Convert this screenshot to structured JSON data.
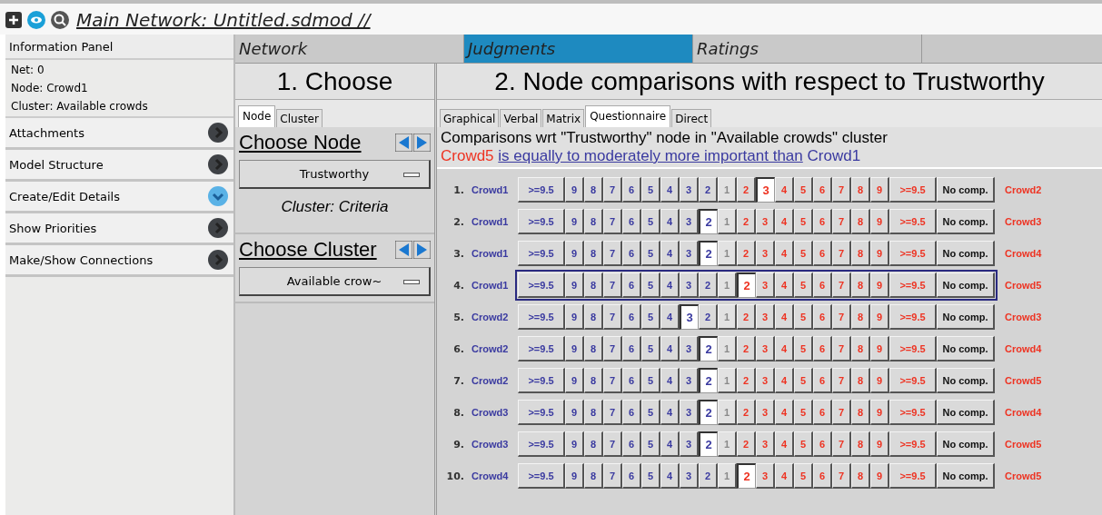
{
  "window": {
    "title": "Main Network: Untitled.sdmod //"
  },
  "sidebar": {
    "header": "Information Panel",
    "info": [
      "Net: 0",
      "Node: Crowd1",
      "Cluster: Available crowds"
    ],
    "sections": [
      {
        "label": "Attachments",
        "expanded": false
      },
      {
        "label": "Model Structure",
        "expanded": false
      },
      {
        "label": "Create/Edit Details",
        "expanded": true
      },
      {
        "label": "Show Priorities",
        "expanded": false
      },
      {
        "label": "Make/Show Connections",
        "expanded": false
      }
    ]
  },
  "main_tabs": [
    {
      "label": "Network",
      "selected": false
    },
    {
      "label": "Judgments",
      "selected": true
    },
    {
      "label": "Ratings",
      "selected": false
    }
  ],
  "choose": {
    "heading": "1. Choose",
    "tabs": [
      {
        "label": "Node",
        "selected": true
      },
      {
        "label": "Cluster",
        "selected": false
      }
    ],
    "node_title": "Choose Node",
    "node_value": "Trustworthy",
    "cluster_note": "Cluster: Criteria",
    "cluster_title": "Choose Cluster",
    "cluster_value": "Available crow~"
  },
  "comparisons": {
    "heading": "2. Node comparisons with respect to Trustworthy",
    "tabs": [
      {
        "label": "Graphical",
        "selected": false
      },
      {
        "label": "Verbal",
        "selected": false
      },
      {
        "label": "Matrix",
        "selected": false
      },
      {
        "label": "Questionnaire",
        "selected": true
      },
      {
        "label": "Direct",
        "selected": false
      }
    ],
    "caption": "Comparisons wrt \"Trustworthy\" node in \"Available crowds\" cluster",
    "verdict": {
      "subject": "Crowd5",
      "phrase": "is equally to moderately more important than",
      "object": "Crowd1"
    },
    "rows": [
      {
        "number": "1.",
        "left": "Crowd1",
        "right": "Crowd2",
        "focused": false,
        "cells": [
          {
            "label": ">=9.5",
            "kind": "left",
            "selected": false
          },
          {
            "label": "9",
            "kind": "left",
            "selected": false
          },
          {
            "label": "8",
            "kind": "left",
            "selected": false
          },
          {
            "label": "7",
            "kind": "left",
            "selected": false
          },
          {
            "label": "6",
            "kind": "left",
            "selected": false
          },
          {
            "label": "5",
            "kind": "left",
            "selected": false
          },
          {
            "label": "4",
            "kind": "left",
            "selected": false
          },
          {
            "label": "3",
            "kind": "left",
            "selected": false
          },
          {
            "label": "2",
            "kind": "left",
            "selected": false
          },
          {
            "label": "1",
            "kind": "middle",
            "selected": false
          },
          {
            "label": "2",
            "kind": "right",
            "selected": false
          },
          {
            "label": "3",
            "kind": "right",
            "selected": true
          },
          {
            "label": "4",
            "kind": "right",
            "selected": false
          },
          {
            "label": "5",
            "kind": "right",
            "selected": false
          },
          {
            "label": "6",
            "kind": "right",
            "selected": false
          },
          {
            "label": "7",
            "kind": "right",
            "selected": false
          },
          {
            "label": "8",
            "kind": "right",
            "selected": false
          },
          {
            "label": "9",
            "kind": "right",
            "selected": false
          },
          {
            "label": ">=9.5",
            "kind": "right",
            "selected": false
          },
          {
            "label": "No comp.",
            "kind": "none",
            "selected": false
          }
        ]
      },
      {
        "number": "2.",
        "left": "Crowd1",
        "right": "Crowd3",
        "focused": false,
        "cells": [
          {
            "label": ">=9.5",
            "kind": "left",
            "selected": false
          },
          {
            "label": "9",
            "kind": "left",
            "selected": false
          },
          {
            "label": "8",
            "kind": "left",
            "selected": false
          },
          {
            "label": "7",
            "kind": "left",
            "selected": false
          },
          {
            "label": "6",
            "kind": "left",
            "selected": false
          },
          {
            "label": "5",
            "kind": "left",
            "selected": false
          },
          {
            "label": "4",
            "kind": "left",
            "selected": false
          },
          {
            "label": "3",
            "kind": "left",
            "selected": false
          },
          {
            "label": "2",
            "kind": "left",
            "selected": true
          },
          {
            "label": "1",
            "kind": "middle",
            "selected": false
          },
          {
            "label": "2",
            "kind": "right",
            "selected": false
          },
          {
            "label": "3",
            "kind": "right",
            "selected": false
          },
          {
            "label": "4",
            "kind": "right",
            "selected": false
          },
          {
            "label": "5",
            "kind": "right",
            "selected": false
          },
          {
            "label": "6",
            "kind": "right",
            "selected": false
          },
          {
            "label": "7",
            "kind": "right",
            "selected": false
          },
          {
            "label": "8",
            "kind": "right",
            "selected": false
          },
          {
            "label": "9",
            "kind": "right",
            "selected": false
          },
          {
            "label": ">=9.5",
            "kind": "right",
            "selected": false
          },
          {
            "label": "No comp.",
            "kind": "none",
            "selected": false
          }
        ]
      },
      {
        "number": "3.",
        "left": "Crowd1",
        "right": "Crowd4",
        "focused": false,
        "cells": [
          {
            "label": ">=9.5",
            "kind": "left",
            "selected": false
          },
          {
            "label": "9",
            "kind": "left",
            "selected": false
          },
          {
            "label": "8",
            "kind": "left",
            "selected": false
          },
          {
            "label": "7",
            "kind": "left",
            "selected": false
          },
          {
            "label": "6",
            "kind": "left",
            "selected": false
          },
          {
            "label": "5",
            "kind": "left",
            "selected": false
          },
          {
            "label": "4",
            "kind": "left",
            "selected": false
          },
          {
            "label": "3",
            "kind": "left",
            "selected": false
          },
          {
            "label": "2",
            "kind": "left",
            "selected": true
          },
          {
            "label": "1",
            "kind": "middle",
            "selected": false
          },
          {
            "label": "2",
            "kind": "right",
            "selected": false
          },
          {
            "label": "3",
            "kind": "right",
            "selected": false
          },
          {
            "label": "4",
            "kind": "right",
            "selected": false
          },
          {
            "label": "5",
            "kind": "right",
            "selected": false
          },
          {
            "label": "6",
            "kind": "right",
            "selected": false
          },
          {
            "label": "7",
            "kind": "right",
            "selected": false
          },
          {
            "label": "8",
            "kind": "right",
            "selected": false
          },
          {
            "label": "9",
            "kind": "right",
            "selected": false
          },
          {
            "label": ">=9.5",
            "kind": "right",
            "selected": false
          },
          {
            "label": "No comp.",
            "kind": "none",
            "selected": false
          }
        ]
      },
      {
        "number": "4.",
        "left": "Crowd1",
        "right": "Crowd5",
        "focused": true,
        "cells": [
          {
            "label": ">=9.5",
            "kind": "left",
            "selected": false
          },
          {
            "label": "9",
            "kind": "left",
            "selected": false
          },
          {
            "label": "8",
            "kind": "left",
            "selected": false
          },
          {
            "label": "7",
            "kind": "left",
            "selected": false
          },
          {
            "label": "6",
            "kind": "left",
            "selected": false
          },
          {
            "label": "5",
            "kind": "left",
            "selected": false
          },
          {
            "label": "4",
            "kind": "left",
            "selected": false
          },
          {
            "label": "3",
            "kind": "left",
            "selected": false
          },
          {
            "label": "2",
            "kind": "left",
            "selected": false
          },
          {
            "label": "1",
            "kind": "middle",
            "selected": false
          },
          {
            "label": "2",
            "kind": "right",
            "selected": true
          },
          {
            "label": "3",
            "kind": "right",
            "selected": false
          },
          {
            "label": "4",
            "kind": "right",
            "selected": false
          },
          {
            "label": "5",
            "kind": "right",
            "selected": false
          },
          {
            "label": "6",
            "kind": "right",
            "selected": false
          },
          {
            "label": "7",
            "kind": "right",
            "selected": false
          },
          {
            "label": "8",
            "kind": "right",
            "selected": false
          },
          {
            "label": "9",
            "kind": "right",
            "selected": false
          },
          {
            "label": ">=9.5",
            "kind": "right",
            "selected": false
          },
          {
            "label": "No comp.",
            "kind": "none",
            "selected": false
          }
        ]
      },
      {
        "number": "5.",
        "left": "Crowd2",
        "right": "Crowd3",
        "focused": false,
        "cells": [
          {
            "label": ">=9.5",
            "kind": "left",
            "selected": false
          },
          {
            "label": "9",
            "kind": "left",
            "selected": false
          },
          {
            "label": "8",
            "kind": "left",
            "selected": false
          },
          {
            "label": "7",
            "kind": "left",
            "selected": false
          },
          {
            "label": "6",
            "kind": "left",
            "selected": false
          },
          {
            "label": "5",
            "kind": "left",
            "selected": false
          },
          {
            "label": "4",
            "kind": "left",
            "selected": false
          },
          {
            "label": "3",
            "kind": "left",
            "selected": true
          },
          {
            "label": "2",
            "kind": "left",
            "selected": false
          },
          {
            "label": "1",
            "kind": "middle",
            "selected": false
          },
          {
            "label": "2",
            "kind": "right",
            "selected": false
          },
          {
            "label": "3",
            "kind": "right",
            "selected": false
          },
          {
            "label": "4",
            "kind": "right",
            "selected": false
          },
          {
            "label": "5",
            "kind": "right",
            "selected": false
          },
          {
            "label": "6",
            "kind": "right",
            "selected": false
          },
          {
            "label": "7",
            "kind": "right",
            "selected": false
          },
          {
            "label": "8",
            "kind": "right",
            "selected": false
          },
          {
            "label": "9",
            "kind": "right",
            "selected": false
          },
          {
            "label": ">=9.5",
            "kind": "right",
            "selected": false
          },
          {
            "label": "No comp.",
            "kind": "none",
            "selected": false
          }
        ]
      },
      {
        "number": "6.",
        "left": "Crowd2",
        "right": "Crowd4",
        "focused": false,
        "cells": [
          {
            "label": ">=9.5",
            "kind": "left",
            "selected": false
          },
          {
            "label": "9",
            "kind": "left",
            "selected": false
          },
          {
            "label": "8",
            "kind": "left",
            "selected": false
          },
          {
            "label": "7",
            "kind": "left",
            "selected": false
          },
          {
            "label": "6",
            "kind": "left",
            "selected": false
          },
          {
            "label": "5",
            "kind": "left",
            "selected": false
          },
          {
            "label": "4",
            "kind": "left",
            "selected": false
          },
          {
            "label": "3",
            "kind": "left",
            "selected": false
          },
          {
            "label": "2",
            "kind": "left",
            "selected": true
          },
          {
            "label": "1",
            "kind": "middle",
            "selected": false
          },
          {
            "label": "2",
            "kind": "right",
            "selected": false
          },
          {
            "label": "3",
            "kind": "right",
            "selected": false
          },
          {
            "label": "4",
            "kind": "right",
            "selected": false
          },
          {
            "label": "5",
            "kind": "right",
            "selected": false
          },
          {
            "label": "6",
            "kind": "right",
            "selected": false
          },
          {
            "label": "7",
            "kind": "right",
            "selected": false
          },
          {
            "label": "8",
            "kind": "right",
            "selected": false
          },
          {
            "label": "9",
            "kind": "right",
            "selected": false
          },
          {
            "label": ">=9.5",
            "kind": "right",
            "selected": false
          },
          {
            "label": "No comp.",
            "kind": "none",
            "selected": false
          }
        ]
      },
      {
        "number": "7.",
        "left": "Crowd2",
        "right": "Crowd5",
        "focused": false,
        "cells": [
          {
            "label": ">=9.5",
            "kind": "left",
            "selected": false
          },
          {
            "label": "9",
            "kind": "left",
            "selected": false
          },
          {
            "label": "8",
            "kind": "left",
            "selected": false
          },
          {
            "label": "7",
            "kind": "left",
            "selected": false
          },
          {
            "label": "6",
            "kind": "left",
            "selected": false
          },
          {
            "label": "5",
            "kind": "left",
            "selected": false
          },
          {
            "label": "4",
            "kind": "left",
            "selected": false
          },
          {
            "label": "3",
            "kind": "left",
            "selected": false
          },
          {
            "label": "2",
            "kind": "left",
            "selected": true
          },
          {
            "label": "1",
            "kind": "middle",
            "selected": false
          },
          {
            "label": "2",
            "kind": "right",
            "selected": false
          },
          {
            "label": "3",
            "kind": "right",
            "selected": false
          },
          {
            "label": "4",
            "kind": "right",
            "selected": false
          },
          {
            "label": "5",
            "kind": "right",
            "selected": false
          },
          {
            "label": "6",
            "kind": "right",
            "selected": false
          },
          {
            "label": "7",
            "kind": "right",
            "selected": false
          },
          {
            "label": "8",
            "kind": "right",
            "selected": false
          },
          {
            "label": "9",
            "kind": "right",
            "selected": false
          },
          {
            "label": ">=9.5",
            "kind": "right",
            "selected": false
          },
          {
            "label": "No comp.",
            "kind": "none",
            "selected": false
          }
        ]
      },
      {
        "number": "8.",
        "left": "Crowd3",
        "right": "Crowd4",
        "focused": false,
        "cells": [
          {
            "label": ">=9.5",
            "kind": "left",
            "selected": false
          },
          {
            "label": "9",
            "kind": "left",
            "selected": false
          },
          {
            "label": "8",
            "kind": "left",
            "selected": false
          },
          {
            "label": "7",
            "kind": "left",
            "selected": false
          },
          {
            "label": "6",
            "kind": "left",
            "selected": false
          },
          {
            "label": "5",
            "kind": "left",
            "selected": false
          },
          {
            "label": "4",
            "kind": "left",
            "selected": false
          },
          {
            "label": "3",
            "kind": "left",
            "selected": false
          },
          {
            "label": "2",
            "kind": "left",
            "selected": true
          },
          {
            "label": "1",
            "kind": "middle",
            "selected": false
          },
          {
            "label": "2",
            "kind": "right",
            "selected": false
          },
          {
            "label": "3",
            "kind": "right",
            "selected": false
          },
          {
            "label": "4",
            "kind": "right",
            "selected": false
          },
          {
            "label": "5",
            "kind": "right",
            "selected": false
          },
          {
            "label": "6",
            "kind": "right",
            "selected": false
          },
          {
            "label": "7",
            "kind": "right",
            "selected": false
          },
          {
            "label": "8",
            "kind": "right",
            "selected": false
          },
          {
            "label": "9",
            "kind": "right",
            "selected": false
          },
          {
            "label": ">=9.5",
            "kind": "right",
            "selected": false
          },
          {
            "label": "No comp.",
            "kind": "none",
            "selected": false
          }
        ]
      },
      {
        "number": "9.",
        "left": "Crowd3",
        "right": "Crowd5",
        "focused": false,
        "cells": [
          {
            "label": ">=9.5",
            "kind": "left",
            "selected": false
          },
          {
            "label": "9",
            "kind": "left",
            "selected": false
          },
          {
            "label": "8",
            "kind": "left",
            "selected": false
          },
          {
            "label": "7",
            "kind": "left",
            "selected": false
          },
          {
            "label": "6",
            "kind": "left",
            "selected": false
          },
          {
            "label": "5",
            "kind": "left",
            "selected": false
          },
          {
            "label": "4",
            "kind": "left",
            "selected": false
          },
          {
            "label": "3",
            "kind": "left",
            "selected": false
          },
          {
            "label": "2",
            "kind": "left",
            "selected": true
          },
          {
            "label": "1",
            "kind": "middle",
            "selected": false
          },
          {
            "label": "2",
            "kind": "right",
            "selected": false
          },
          {
            "label": "3",
            "kind": "right",
            "selected": false
          },
          {
            "label": "4",
            "kind": "right",
            "selected": false
          },
          {
            "label": "5",
            "kind": "right",
            "selected": false
          },
          {
            "label": "6",
            "kind": "right",
            "selected": false
          },
          {
            "label": "7",
            "kind": "right",
            "selected": false
          },
          {
            "label": "8",
            "kind": "right",
            "selected": false
          },
          {
            "label": "9",
            "kind": "right",
            "selected": false
          },
          {
            "label": ">=9.5",
            "kind": "right",
            "selected": false
          },
          {
            "label": "No comp.",
            "kind": "none",
            "selected": false
          }
        ]
      },
      {
        "number": "10.",
        "left": "Crowd4",
        "right": "Crowd5",
        "focused": false,
        "cells": [
          {
            "label": ">=9.5",
            "kind": "left",
            "selected": false
          },
          {
            "label": "9",
            "kind": "left",
            "selected": false
          },
          {
            "label": "8",
            "kind": "left",
            "selected": false
          },
          {
            "label": "7",
            "kind": "left",
            "selected": false
          },
          {
            "label": "6",
            "kind": "left",
            "selected": false
          },
          {
            "label": "5",
            "kind": "left",
            "selected": false
          },
          {
            "label": "4",
            "kind": "left",
            "selected": false
          },
          {
            "label": "3",
            "kind": "left",
            "selected": false
          },
          {
            "label": "2",
            "kind": "left",
            "selected": false
          },
          {
            "label": "1",
            "kind": "middle",
            "selected": false
          },
          {
            "label": "2",
            "kind": "right",
            "selected": true
          },
          {
            "label": "3",
            "kind": "right",
            "selected": false
          },
          {
            "label": "4",
            "kind": "right",
            "selected": false
          },
          {
            "label": "5",
            "kind": "right",
            "selected": false
          },
          {
            "label": "6",
            "kind": "right",
            "selected": false
          },
          {
            "label": "7",
            "kind": "right",
            "selected": false
          },
          {
            "label": "8",
            "kind": "right",
            "selected": false
          },
          {
            "label": "9",
            "kind": "right",
            "selected": false
          },
          {
            "label": ">=9.5",
            "kind": "right",
            "selected": false
          },
          {
            "label": "No comp.",
            "kind": "none",
            "selected": false
          }
        ]
      }
    ]
  }
}
